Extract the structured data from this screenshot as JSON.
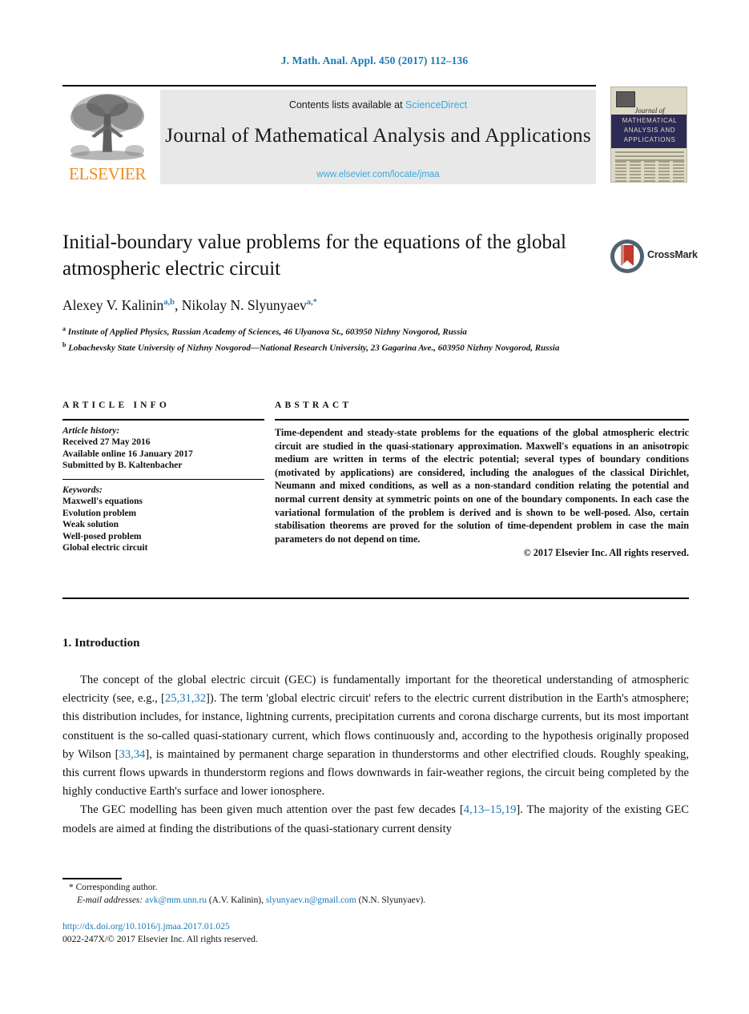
{
  "running_head": "J. Math. Anal. Appl. 450 (2017) 112–136",
  "masthead": {
    "publisher_name": "ELSEVIER",
    "contents_prefix": "Contents lists available at ",
    "sciencedirect": "ScienceDirect",
    "journal_title": "Journal of Mathematical Analysis and Applications",
    "journal_url": "www.elsevier.com/locate/jmaa",
    "cover": {
      "script_word": "Journal of",
      "band_line1": "MATHEMATICAL",
      "band_line2": "ANALYSIS AND",
      "band_line3": "APPLICATIONS"
    }
  },
  "article": {
    "title": "Initial-boundary value problems for the equations of the global atmospheric electric circuit",
    "authors_plain": "Alexey V. Kalinin",
    "author1": "Alexey V. Kalinin",
    "author1_sup": "a,b",
    "author_sep": ", ",
    "author2": "Nikolay N. Slyunyaev",
    "author2_sup": "a,*",
    "affiliation_a_marker": "a",
    "affiliation_a": "Institute of Applied Physics, Russian Academy of Sciences, 46 Ulyanova St., 603950 Nizhny Novgorod, Russia",
    "affiliation_b_marker": "b",
    "affiliation_b": "Lobachevsky State University of Nizhny Novgorod—National Research University, 23 Gagarina Ave., 603950 Nizhny Novgorod, Russia"
  },
  "crossmark": {
    "label": "CrossMark",
    "ring_color": "#51626f",
    "bookmark_color": "#c0392b"
  },
  "article_info": {
    "heading": "ARTICLE INFO",
    "history_label": "Article history:",
    "history": [
      "Received 27 May 2016",
      "Available online 16 January 2017",
      "Submitted by B. Kaltenbacher"
    ],
    "keywords_label": "Keywords:",
    "keywords": [
      "Maxwell's equations",
      "Evolution problem",
      "Weak solution",
      "Well-posed problem",
      "Global electric circuit"
    ]
  },
  "abstract": {
    "heading": "ABSTRACT",
    "text": "Time-dependent and steady-state problems for the equations of the global atmospheric electric circuit are studied in the quasi-stationary approximation. Maxwell's equations in an anisotropic medium are written in terms of the electric potential; several types of boundary conditions (motivated by applications) are considered, including the analogues of the classical Dirichlet, Neumann and mixed conditions, as well as a non-standard condition relating the potential and normal current density at symmetric points on one of the boundary components. In each case the variational formulation of the problem is derived and is shown to be well-posed. Also, certain stabilisation theorems are proved for the solution of time-dependent problem in case the main parameters do not depend on time.",
    "copyright": "© 2017 Elsevier Inc. All rights reserved."
  },
  "body": {
    "section_heading": "1. Introduction",
    "para1_part1": "The concept of the global electric circuit (GEC) is fundamentally important for the theoretical understanding of atmospheric electricity (see, e.g., [",
    "para1_cit1": "25,31,32",
    "para1_part2": "]). The term 'global electric circuit' refers to the electric current distribution in the Earth's atmosphere; this distribution includes, for instance, lightning currents, precipitation currents and corona discharge currents, but its most important constituent is the so-called quasi-stationary current, which flows continuously and, according to the hypothesis originally proposed by Wilson [",
    "para1_cit2": "33,34",
    "para1_part3": "], is maintained by permanent charge separation in thunderstorms and other electrified clouds. Roughly speaking, this current flows upwards in thunderstorm regions and flows downwards in fair-weather regions, the circuit being completed by the highly conductive Earth's surface and lower ionosphere.",
    "para2_part1": "The GEC modelling has been given much attention over the past few decades [",
    "para2_cit1": "4,13–15,19",
    "para2_part2": "]. The majority of the existing GEC models are aimed at finding the distributions of the quasi-stationary current density"
  },
  "footer": {
    "corresponding_marker": "*",
    "corresponding_text": "Corresponding author.",
    "email_label": "E-mail addresses:",
    "email1": "avk@mm.unn.ru",
    "email1_owner": "(A.V. Kalinin),",
    "email2": "slyunyaev.n@gmail.com",
    "email2_owner": "(N.N. Slyunyaev).",
    "doi": "http://dx.doi.org/10.1016/j.jmaa.2017.01.025",
    "issn_line": "0022-247X/© 2017 Elsevier Inc. All rights reserved."
  },
  "colors": {
    "link_blue": "#1a7ab5",
    "sciencedirect_blue": "#3aa8dd",
    "elsevier_orange": "#f08c22",
    "cover_band": "#2d2a56"
  }
}
